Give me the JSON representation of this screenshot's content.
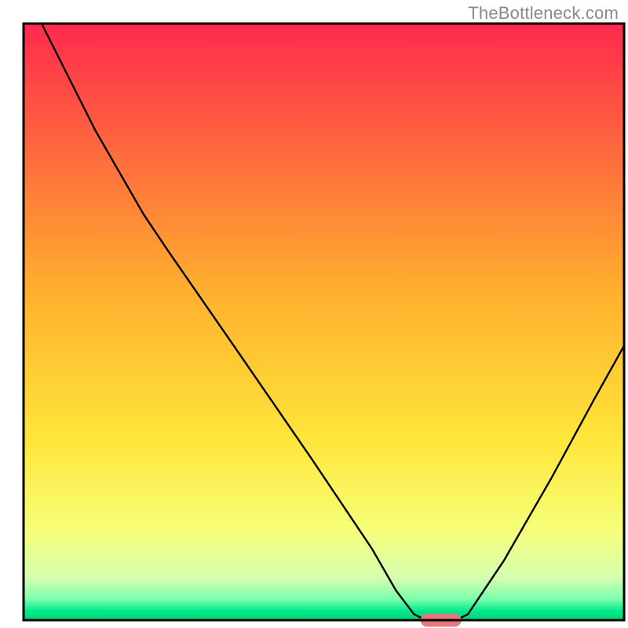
{
  "attribution": "TheBottleneck.com",
  "chart_data": {
    "type": "line",
    "title": "",
    "xlabel": "",
    "ylabel": "",
    "xlim": [
      0,
      100
    ],
    "ylim": [
      0,
      100
    ],
    "background_gradient": {
      "stops": [
        {
          "offset": 0.0,
          "color": "#ff2a4d"
        },
        {
          "offset": 0.45,
          "color": "#ffb02e"
        },
        {
          "offset": 0.7,
          "color": "#ffe63a"
        },
        {
          "offset": 0.85,
          "color": "#f6ff7a"
        },
        {
          "offset": 0.93,
          "color": "#d4ffb0"
        },
        {
          "offset": 0.965,
          "color": "#7affad"
        },
        {
          "offset": 0.985,
          "color": "#00e98a"
        },
        {
          "offset": 1.0,
          "color": "#00d47a"
        }
      ]
    },
    "curve": [
      {
        "x": 3,
        "y": 100
      },
      {
        "x": 12,
        "y": 82
      },
      {
        "x": 20,
        "y": 68
      },
      {
        "x": 24,
        "y": 62
      },
      {
        "x": 35,
        "y": 46
      },
      {
        "x": 48,
        "y": 27
      },
      {
        "x": 58,
        "y": 12
      },
      {
        "x": 62,
        "y": 5
      },
      {
        "x": 65,
        "y": 1
      },
      {
        "x": 67,
        "y": 0
      },
      {
        "x": 72,
        "y": 0
      },
      {
        "x": 74,
        "y": 1
      },
      {
        "x": 80,
        "y": 10
      },
      {
        "x": 88,
        "y": 24
      },
      {
        "x": 95,
        "y": 37
      },
      {
        "x": 100,
        "y": 46
      }
    ],
    "marker": {
      "x": 69.5,
      "y": 0,
      "width": 6.8,
      "height": 2.2,
      "color": "#e7787d"
    },
    "frame_color": "#000000",
    "curve_color": "#000000",
    "curve_width": 2.4
  }
}
